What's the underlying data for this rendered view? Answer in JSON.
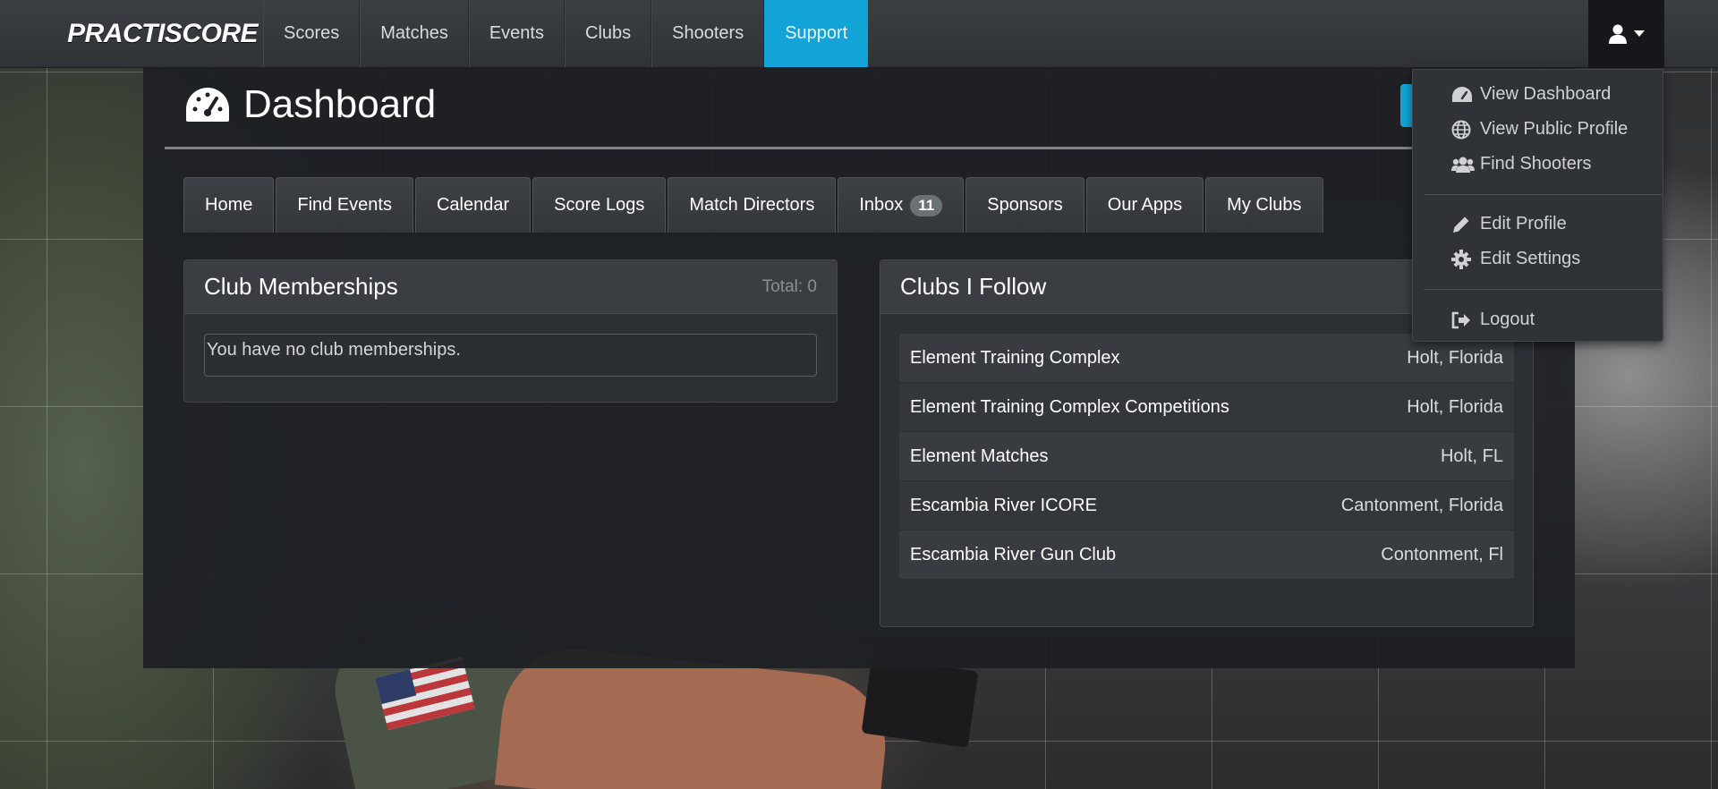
{
  "brand": "PRACTISCORE",
  "nav": [
    "Scores",
    "Matches",
    "Events",
    "Clubs",
    "Shooters",
    "Support"
  ],
  "nav_active": "Support",
  "page_title": "Dashboard",
  "tabs": [
    "Home",
    "Find Events",
    "Calendar",
    "Score Logs",
    "Match Directors",
    "Inbox",
    "Sponsors",
    "Our Apps",
    "My Clubs"
  ],
  "inbox_count": "11",
  "memberships": {
    "title": "Club Memberships",
    "total": "Total: 0",
    "empty": "You have no club memberships."
  },
  "follows": {
    "title": "Clubs I Follow",
    "clubs": [
      {
        "name": "Element Training Complex",
        "location": "Holt, Florida"
      },
      {
        "name": "Element Training Complex Competitions",
        "location": "Holt, Florida"
      },
      {
        "name": "Element Matches",
        "location": "Holt, FL"
      },
      {
        "name": "Escambia River ICORE",
        "location": "Cantonment, Florida"
      },
      {
        "name": "Escambia River Gun Club",
        "location": "Contonment, Fl"
      }
    ]
  },
  "user_menu": {
    "view_dashboard": "View Dashboard",
    "view_public_profile": "View Public Profile",
    "find_shooters": "Find Shooters",
    "edit_profile": "Edit Profile",
    "edit_settings": "Edit Settings",
    "logout": "Logout"
  },
  "colors": {
    "accent": "#12a4d6",
    "navbar": "#343a3f",
    "panel": "#1d1f24"
  },
  "icons": {
    "title": "gauge-icon",
    "user": "user-icon"
  }
}
